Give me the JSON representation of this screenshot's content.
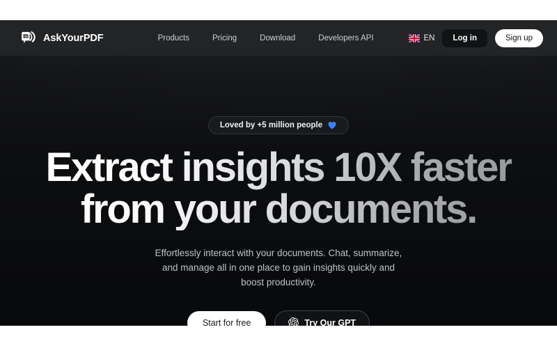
{
  "site": {
    "brand_name": "AskYourPDF",
    "brand_logo_icon": "askyourpdf-document-logo-icon"
  },
  "header": {
    "nav": [
      {
        "label": "Products"
      },
      {
        "label": "Pricing"
      },
      {
        "label": "Download"
      },
      {
        "label": "Developers API"
      }
    ],
    "language": {
      "code": "EN",
      "flag_icon": "uk-flag-icon"
    },
    "login_label": "Log in",
    "signup_label": "Sign up"
  },
  "hero": {
    "badge": {
      "text": "Loved by +5 million people",
      "icon": "blue-heart-icon"
    },
    "title_line_1": "Extract insights 10X faster",
    "title_line_2": "from your documents.",
    "subtitle_line_1": "Effortlessly interact with your documents. Chat, summarize,",
    "subtitle_line_2": "and manage all in one place to gain insights quickly and",
    "subtitle_line_3": "boost productivity.",
    "primary_cta": "Start for free",
    "secondary_cta": "Try Our GPT",
    "secondary_cta_icon": "openai-logo-icon"
  },
  "colors": {
    "page_background": "#0b0c0e",
    "header_background": "#232426",
    "accent_blue": "#3b82f6",
    "text_primary": "#ffffff",
    "text_muted": "#bfc2c7"
  }
}
